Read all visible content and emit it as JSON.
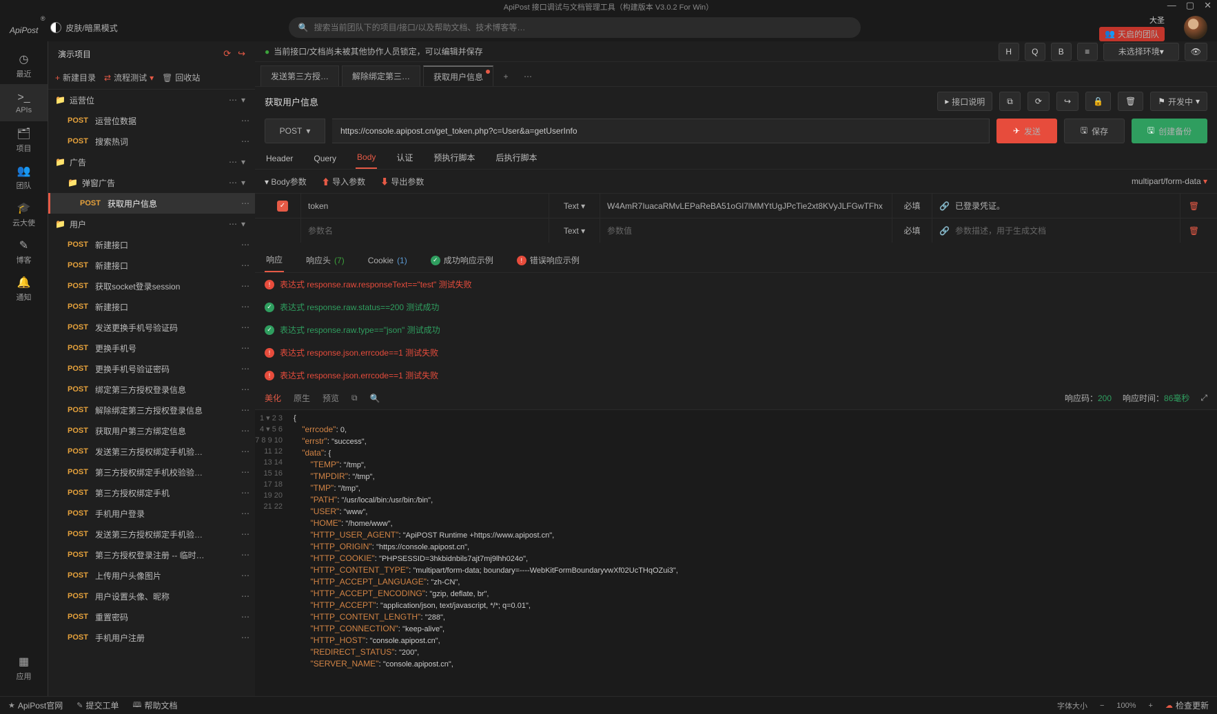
{
  "titlebar": {
    "title": "ApiPost 接口调试与文档管理工具（构建版本 V3.0.2 For Win）"
  },
  "header": {
    "logo": "ApiPost",
    "theme": "皮肤/暗黑模式",
    "search_placeholder": "搜索当前团队下的项目/接口/以及帮助文档、技术博客等…",
    "username": "大圣",
    "team_badge": "天启的团队"
  },
  "rail": {
    "items": [
      {
        "icon": "◷",
        "label": "最近"
      },
      {
        "icon": ">_",
        "label": "APIs"
      },
      {
        "icon": "🗂",
        "label": "项目"
      },
      {
        "icon": "👥",
        "label": "团队"
      },
      {
        "icon": "🎓",
        "label": "云大使"
      },
      {
        "icon": "✎",
        "label": "博客"
      },
      {
        "icon": "🔔",
        "label": "通知"
      }
    ],
    "bottom": {
      "icon": "▦",
      "label": "应用"
    }
  },
  "sidebar": {
    "project": "演示项目",
    "toolbar": {
      "new": "新建目录",
      "flow": "流程测试",
      "recycle": "回收站"
    },
    "tree": [
      {
        "type": "folder",
        "indent": 0,
        "name": "运营位",
        "open": true
      },
      {
        "type": "api",
        "indent": 1,
        "method": "POST",
        "name": "运营位数据"
      },
      {
        "type": "api",
        "indent": 1,
        "method": "POST",
        "name": "搜索热词"
      },
      {
        "type": "folder",
        "indent": 0,
        "name": "广告",
        "open": true
      },
      {
        "type": "folder",
        "indent": 1,
        "name": "弹窗广告",
        "open": true
      },
      {
        "type": "api",
        "indent": 2,
        "method": "POST",
        "name": "获取用户信息",
        "selected": true
      },
      {
        "type": "folder",
        "indent": 0,
        "name": "用户",
        "open": true
      },
      {
        "type": "api",
        "indent": 1,
        "method": "POST",
        "name": "新建接口"
      },
      {
        "type": "api",
        "indent": 1,
        "method": "POST",
        "name": "新建接口"
      },
      {
        "type": "api",
        "indent": 1,
        "method": "POST",
        "name": "获取socket登录session"
      },
      {
        "type": "api",
        "indent": 1,
        "method": "POST",
        "name": "新建接口"
      },
      {
        "type": "api",
        "indent": 1,
        "method": "POST",
        "name": "发送更换手机号验证码"
      },
      {
        "type": "api",
        "indent": 1,
        "method": "POST",
        "name": "更换手机号"
      },
      {
        "type": "api",
        "indent": 1,
        "method": "POST",
        "name": "更换手机号验证密码"
      },
      {
        "type": "api",
        "indent": 1,
        "method": "POST",
        "name": "绑定第三方授权登录信息"
      },
      {
        "type": "api",
        "indent": 1,
        "method": "POST",
        "name": "解除绑定第三方授权登录信息"
      },
      {
        "type": "api",
        "indent": 1,
        "method": "POST",
        "name": "获取用户第三方绑定信息"
      },
      {
        "type": "api",
        "indent": 1,
        "method": "POST",
        "name": "发送第三方授权绑定手机验…"
      },
      {
        "type": "api",
        "indent": 1,
        "method": "POST",
        "name": "第三方授权绑定手机校验验…"
      },
      {
        "type": "api",
        "indent": 1,
        "method": "POST",
        "name": "第三方授权绑定手机"
      },
      {
        "type": "api",
        "indent": 1,
        "method": "POST",
        "name": "手机用户登录"
      },
      {
        "type": "api",
        "indent": 1,
        "method": "POST",
        "name": "发送第三方授权绑定手机验…"
      },
      {
        "type": "api",
        "indent": 1,
        "method": "POST",
        "name": "第三方授权登录注册 -- 临时…"
      },
      {
        "type": "api",
        "indent": 1,
        "method": "POST",
        "name": "上传用户头像图片"
      },
      {
        "type": "api",
        "indent": 1,
        "method": "POST",
        "name": "用户设置头像、昵称"
      },
      {
        "type": "api",
        "indent": 1,
        "method": "POST",
        "name": "重置密码"
      },
      {
        "type": "api",
        "indent": 1,
        "method": "POST",
        "name": "手机用户注册"
      }
    ]
  },
  "lockbar": {
    "text": "当前接口/文档尚未被其他协作人员锁定，可以编辑并保存",
    "btns": [
      "H",
      "Q",
      "B"
    ],
    "env": "未选择环境"
  },
  "tabs": [
    {
      "label": "发送第三方授…"
    },
    {
      "label": "解除绑定第三…"
    },
    {
      "label": "获取用户信息",
      "active": true,
      "dirty": true
    }
  ],
  "api": {
    "title": "获取用户信息",
    "desc_btn": "接口说明",
    "dev_btn": "开发中",
    "method": "POST",
    "url": "https://console.apipost.cn/get_token.php?c=User&a=getUserInfo",
    "send": "发送",
    "save": "保存",
    "backup": "创建备份"
  },
  "reqtabs": [
    "Header",
    "Query",
    "Body",
    "认证",
    "预执行脚本",
    "后执行脚本"
  ],
  "bodyparam": {
    "label": "Body参数",
    "import": "导入参数",
    "export": "导出参数",
    "format": "multipart/form-data"
  },
  "params": [
    {
      "checked": true,
      "name": "token",
      "type": "Text",
      "value": "W4AmR7IuacaRMvLEPaReBA51oGl7lMMYtUgJPcTie2xt8KVyJLFGwTFhx",
      "req": "必填",
      "desc": "已登录凭证。"
    },
    {
      "checked": false,
      "name_ph": "参数名",
      "type": "Text",
      "value_ph": "参数值",
      "req": "必填",
      "desc_ph": "参数描述，用于生成文档"
    }
  ],
  "resptabs": {
    "items": [
      {
        "label": "响应",
        "active": true
      },
      {
        "label": "响应头",
        "count": "(7)"
      },
      {
        "label": "Cookie",
        "count_blue": "(1)"
      },
      {
        "label": "成功响应示例",
        "status": "ok"
      },
      {
        "label": "错误响应示例",
        "status": "err"
      }
    ]
  },
  "asserts": [
    {
      "status": "fail",
      "text": "表达式 response.raw.responseText==\"test\" 测试失败"
    },
    {
      "status": "pass",
      "text": "表达式 response.raw.status==200 测试成功"
    },
    {
      "status": "pass",
      "text": "表达式 response.raw.type==\"json\" 测试成功"
    },
    {
      "status": "fail",
      "text": "表达式 response.json.errcode==1 测试失败"
    },
    {
      "status": "fail",
      "text": "表达式 response.json.errcode==1 测试失败"
    }
  ],
  "resptoolbar": {
    "beautify": "美化",
    "raw": "原生",
    "preview": "预览",
    "code_label": "响应码：",
    "code": "200",
    "time_label": "响应时间：",
    "time": "86毫秒"
  },
  "response_lines": [
    "{",
    "    \"errcode\": 0,",
    "    \"errstr\": \"success\",",
    "    \"data\": {",
    "        \"TEMP\": \"/tmp\",",
    "        \"TMPDIR\": \"/tmp\",",
    "        \"TMP\": \"/tmp\",",
    "        \"PATH\": \"/usr/local/bin:/usr/bin:/bin\",",
    "        \"USER\": \"www\",",
    "        \"HOME\": \"/home/www\",",
    "        \"HTTP_USER_AGENT\": \"ApiPOST Runtime +https://www.apipost.cn\",",
    "        \"HTTP_ORIGIN\": \"https://console.apipost.cn\",",
    "        \"HTTP_COOKIE\": \"PHPSESSID=3hkbidnbils7ajt7mj9lhh024o\",",
    "        \"HTTP_CONTENT_TYPE\": \"multipart/form-data; boundary=----WebKitFormBoundaryvwXf02UcTHqOZui3\",",
    "        \"HTTP_ACCEPT_LANGUAGE\": \"zh-CN\",",
    "        \"HTTP_ACCEPT_ENCODING\": \"gzip, deflate, br\",",
    "        \"HTTP_ACCEPT\": \"application/json, text/javascript, */*; q=0.01\",",
    "        \"HTTP_CONTENT_LENGTH\": \"288\",",
    "        \"HTTP_CONNECTION\": \"keep-alive\",",
    "        \"HTTP_HOST\": \"console.apipost.cn\",",
    "        \"REDIRECT_STATUS\": \"200\",",
    "        \"SERVER_NAME\": \"console.apipost.cn\","
  ],
  "footer": {
    "site": "ApiPost官网",
    "ticket": "提交工单",
    "help": "帮助文档",
    "fontlabel": "字体大小",
    "zoom": "100%",
    "update": "检查更新"
  }
}
